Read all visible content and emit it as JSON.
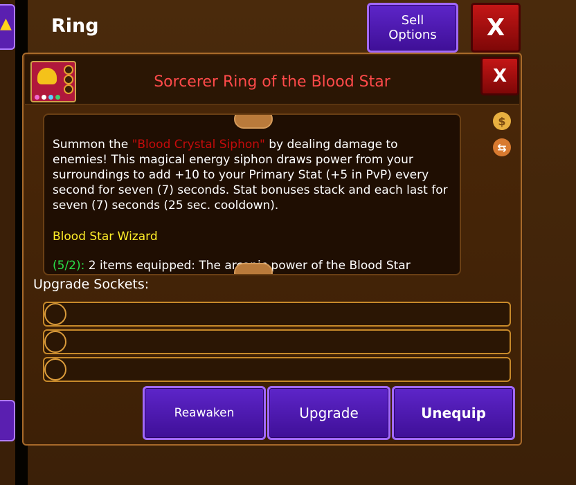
{
  "window": {
    "title": "Ring",
    "sell_options": "Sell\nOptions",
    "close_label": "X"
  },
  "item": {
    "name": "Sorcerer Ring of the Blood Star",
    "close_label": "X",
    "description_pre": "Summon the ",
    "description_highlight": "\"Blood Crystal Siphon\"",
    "description_post": " by dealing damage to enemies! This magical energy siphon draws power from your surroundings to add +10 to your Primary Stat (+5 in PvP) every second for seven (7) seconds. Stat bonuses stack and each last for seven (7) seconds (25 sec. cooldown).",
    "set_name": "Blood Star Wizard",
    "set_bonus_count": "(5/2):",
    "set_bonus_text": " 2 items equipped: The arcanic power of the Blood Star",
    "gem_colors": [
      "#f06ad0",
      "#ffffff",
      "#5ad0ff",
      "#40d070"
    ]
  },
  "sockets": {
    "label": "Upgrade Sockets:",
    "count": 3
  },
  "actions": {
    "reawaken": "Reawaken",
    "upgrade": "Upgrade",
    "unequip": "Unequip"
  },
  "colors": {
    "title_red": "#ff4a4a",
    "set_yellow": "#ffee28",
    "purple": "#5d25c9"
  }
}
